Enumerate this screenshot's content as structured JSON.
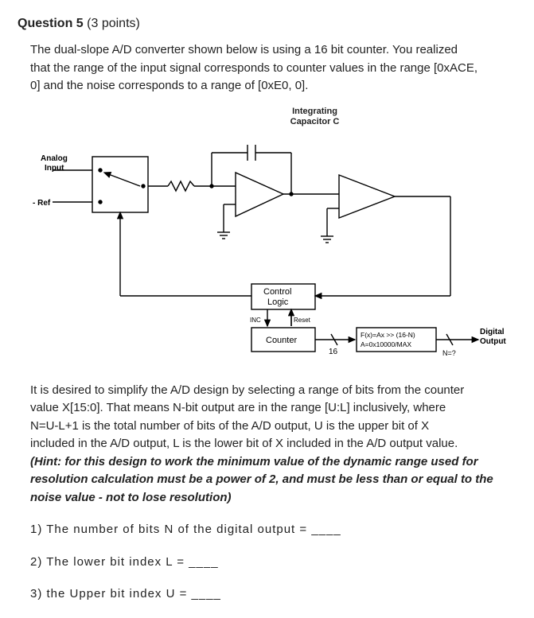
{
  "header": {
    "title": "Question 5",
    "points": "(3 points)"
  },
  "intro": {
    "l1": "The dual-slope A/D converter shown below is using a 16 bit counter. You realized",
    "l2": "that the range of the input signal corresponds to counter values in the range [0xACE,",
    "l3": "0] and the noise corresponds to a range of [0xE0, 0]."
  },
  "diagram": {
    "cap_l1": "Integrating",
    "cap_l2": "Capacitor C",
    "analog_l1": "Analog",
    "analog_l2": "Input",
    "ref": "- Ref",
    "control": "Control",
    "logic": "Logic",
    "inc": "INC",
    "reset": "Reset",
    "counter": "Counter",
    "bus16": "16",
    "fx_l1": "F(x)=Ax >> (16-N)",
    "fx_l2": "A=0x10000/MAX",
    "nq": "N=?",
    "digital_l1": "Digital",
    "digital_l2": "Output"
  },
  "desc": {
    "l1": "It is desired to simplify the A/D design by selecting a range of bits from the counter",
    "l2": "value X[15:0]. That means N-bit output are in the range [U:L] inclusively, where",
    "l3": "N=U-L+1 is the total number of bits of the A/D output, U is the upper bit of X",
    "l4": "included in the A/D output, L is the lower bit of X included in the A/D output value.",
    "hint_l1": "(Hint: for this design to work the minimum value of the dynamic range used for",
    "hint_l2": "resolution calculation must be a power of 2, and must be less than or equal to the",
    "hint_l3": "noise value - not to lose resolution)"
  },
  "questions": {
    "q1": "1) The number of bits N of the digital output = ____",
    "q2": "2) The lower bit index L = ____",
    "q3": "3) the Upper bit index U = ____"
  }
}
